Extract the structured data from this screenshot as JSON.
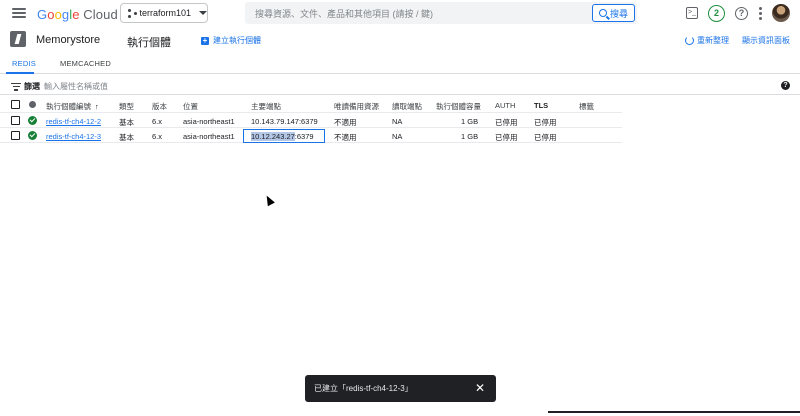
{
  "header": {
    "logo_parts": [
      "G",
      "o",
      "o",
      "g",
      "l",
      "e"
    ],
    "logo_suffix": " Cloud",
    "project": "terraform101",
    "search_placeholder": "搜尋資源、文件、產品和其他項目 (請按 / 鍵)",
    "search_button": "搜尋",
    "notification_count": "2",
    "help_symbol": "?",
    "terminal_symbol": ">_"
  },
  "product": {
    "title": "Memorystore",
    "subtitle": "執行個體",
    "create_label": "建立執行個體",
    "refresh_label": "重新整理",
    "info_panel_label": "顯示資訊面板"
  },
  "tabs": [
    {
      "label": "REDIS",
      "active": true
    },
    {
      "label": "MEMCACHED",
      "active": false
    }
  ],
  "filter": {
    "label": "篩選",
    "placeholder": "輸入屬性名稱或值",
    "help_symbol": "?"
  },
  "table": {
    "columns": [
      "執行個體編號",
      "類型",
      "版本",
      "位置",
      "主要端點",
      "唯讀備用資源",
      "讀取端點",
      "執行個體容量",
      "AUTH",
      "TLS",
      "標籤"
    ],
    "sort_indicator": "↑",
    "rows": [
      {
        "id": "redis-tf-ch4-12-2",
        "type": "基本",
        "version": "6.x",
        "location": "asia-northeast1",
        "endpoint": "10.143.79.147:6379",
        "endpoint_ip": "",
        "endpoint_port": "",
        "replicas": "不適用",
        "read_endpoint": "NA",
        "capacity": "1 GB",
        "auth": "已停用",
        "tls": "已停用"
      },
      {
        "id": "redis-tf-ch4-12-3",
        "type": "基本",
        "version": "6.x",
        "location": "asia-northeast1",
        "endpoint": "",
        "endpoint_ip": "10.12.243.27",
        "endpoint_port": ":6379",
        "replicas": "不適用",
        "read_endpoint": "NA",
        "capacity": "1 GB",
        "auth": "已停用",
        "tls": "已停用"
      }
    ]
  },
  "snackbar": {
    "message": "已建立「redis-tf-ch4-12-3」",
    "close_symbol": "✕"
  },
  "colors": {
    "accent": "#1a73e8",
    "status_ok": "#188038",
    "snackbar_bg": "#202124"
  }
}
